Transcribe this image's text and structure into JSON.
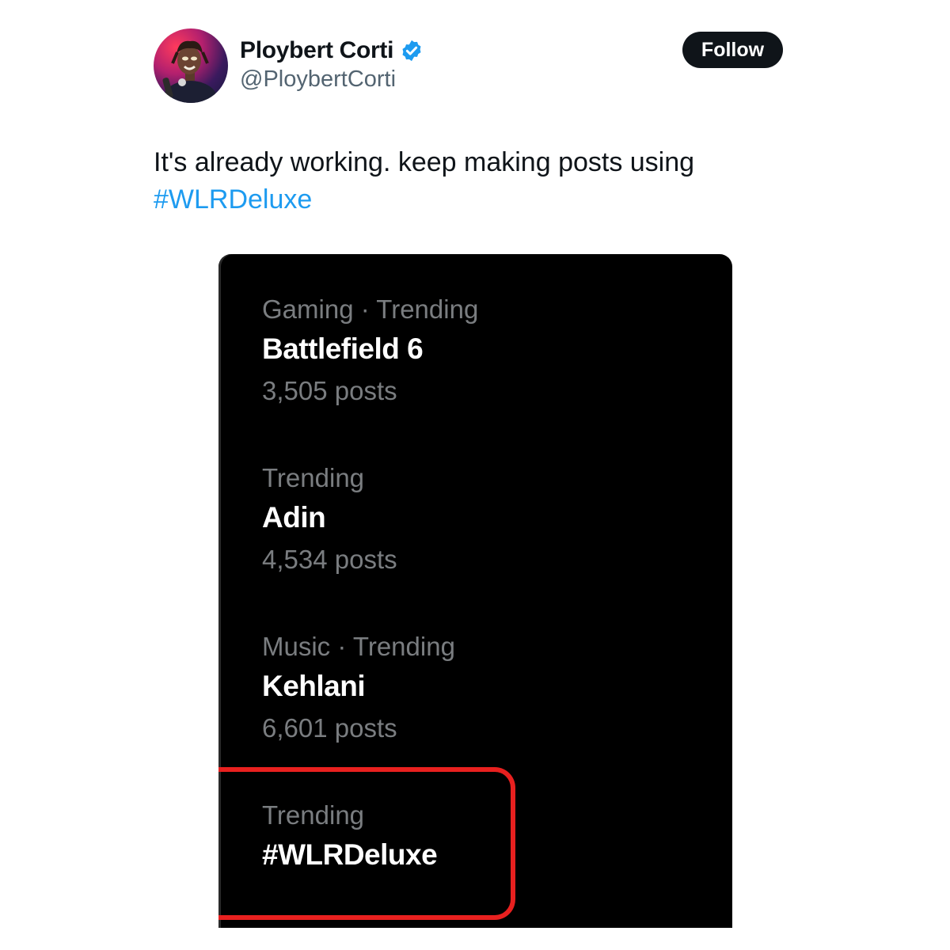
{
  "author": {
    "name": "Ploybert Corti",
    "handle": "@PloybertCorti",
    "verified": true
  },
  "follow_label": "Follow",
  "tweet": {
    "text": "It's already working. keep making posts using",
    "hashtag": "#WLRDeluxe"
  },
  "trends": [
    {
      "meta": "Gaming · Trending",
      "topic": "Battlefield 6",
      "count": "3,505 posts"
    },
    {
      "meta": "Trending",
      "topic": "Adin",
      "count": "4,534 posts"
    },
    {
      "meta": "Music · Trending",
      "topic": "Kehlani",
      "count": "6,601 posts"
    },
    {
      "meta": "Trending",
      "topic": "#WLRDeluxe",
      "count": ""
    }
  ],
  "colors": {
    "link": "#1d9bf0",
    "highlight": "#e8201f",
    "verified_badge": "#1d9bf0"
  }
}
